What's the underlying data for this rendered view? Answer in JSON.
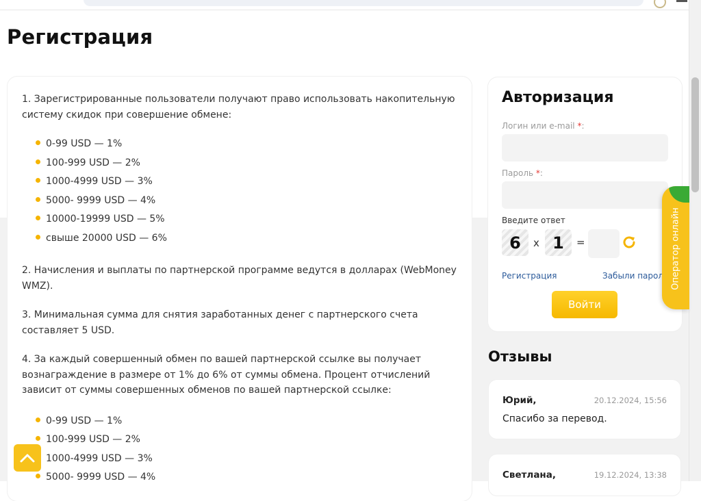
{
  "page": {
    "title": "Регистрация"
  },
  "content": {
    "p1": "1. Зарегистрированные пользователи получают право использовать накопительную систему скидок при совершение обмене:",
    "list1": [
      "0-99 USD — 1%",
      "100-999 USD — 2%",
      "1000-4999 USD — 3%",
      "5000- 9999 USD — 4%",
      "10000-19999 USD — 5%",
      "свыше 20000 USD — 6%"
    ],
    "p2": "2. Начисления и выплаты по партнерской программе ведутся в долларах (WebMoney WMZ).",
    "p3": "3. Минимальная сумма для снятия заработанных денег с партнерского счета составляет 5 USD.",
    "p4": "4. За каждый совершенный обмен по вашей партнерской ссылке вы получает вознаграждение в размере от 1% до 6% от суммы обмена. Процент отчислений зависит от суммы совершенных обменов по вашей партнерской ссылке:",
    "list2": [
      "0-99 USD — 1%",
      "100-999 USD — 2%",
      "1000-4999 USD — 3%",
      "5000- 9999 USD — 4%"
    ]
  },
  "auth": {
    "title": "Авторизация",
    "login_label": "Логин или e-mail",
    "required_mark": "*",
    "colon": ":",
    "password_label": "Пароль",
    "captcha_label": "Введите ответ",
    "captcha_a": "6",
    "captcha_op": "x",
    "captcha_b": "1",
    "captcha_eq": "=",
    "register_link": "Регистрация",
    "forgot_link": "Забыли пароль?",
    "login_button": "Войти"
  },
  "reviews": {
    "title": "Отзывы",
    "items": [
      {
        "name": "Юрий,",
        "date": "20.12.2024, 15:56",
        "text": "Спасибо за перевод."
      },
      {
        "name": "Светлана,",
        "date": "19.12.2024, 13:38",
        "text": ""
      }
    ]
  },
  "widgets": {
    "operator_label": "Оператор онлайн"
  },
  "colors": {
    "accent": "#f7c21b",
    "link": "#2b5a9a",
    "required": "#e53935"
  }
}
